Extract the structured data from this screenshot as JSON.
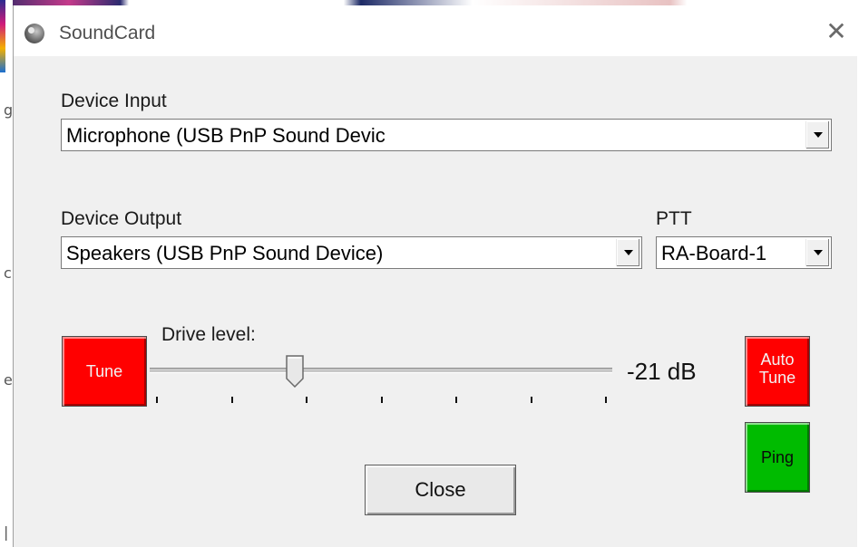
{
  "window": {
    "title": "SoundCard"
  },
  "device_input": {
    "label": "Device Input",
    "value": "Microphone (USB PnP Sound Devic"
  },
  "device_output": {
    "label": "Device Output",
    "value": "Speakers (USB PnP Sound Device)"
  },
  "ptt": {
    "label": "PTT",
    "value": "RA-Board-1"
  },
  "drive": {
    "label": "Drive level:",
    "readout": "-21 dB",
    "level_fraction": 0.31,
    "tick_count": 7
  },
  "buttons": {
    "tune": "Tune",
    "auto_tune_line1": "Auto",
    "auto_tune_line2": "Tune",
    "ping": "Ping",
    "close": "Close"
  },
  "colors": {
    "tune_bg": "#ff0000",
    "ping_bg": "#00bb00"
  }
}
